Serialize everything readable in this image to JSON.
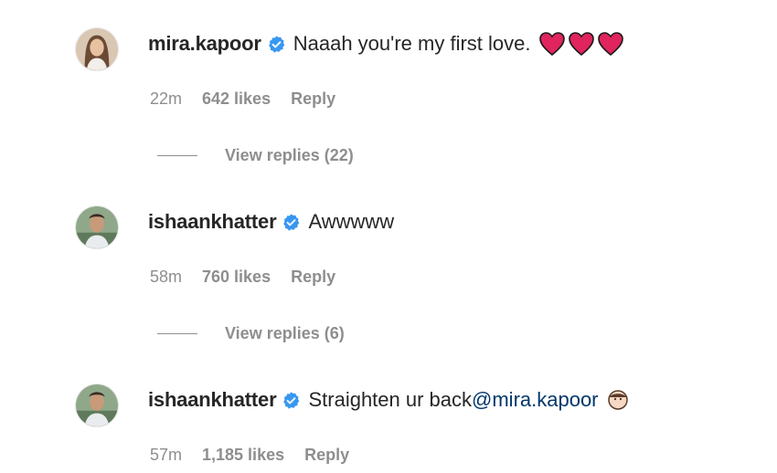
{
  "comments": [
    {
      "username": "mira.kapoor",
      "text": "Naaah you're my first love.",
      "time": "22m",
      "likes": "642 likes",
      "reply": "Reply",
      "view_replies": "View replies (22)",
      "emoji": [
        "red-heart",
        "red-heart",
        "red-heart"
      ]
    },
    {
      "username": "ishaankhatter",
      "text": "Awwwww",
      "time": "58m",
      "likes": "760 likes",
      "reply": "Reply",
      "view_replies": "View replies (6)"
    },
    {
      "username": "ishaankhatter",
      "text": "Straighten ur back ",
      "mention": "@mira.kapoor",
      "time": "57m",
      "likes": "1,185 likes",
      "reply": "Reply",
      "emoji": [
        "face"
      ]
    }
  ],
  "colors": {
    "username": "#262626",
    "meta": "#8e8e8e",
    "verified": "#3897f0",
    "heart": "#e0245e",
    "mention": "#00376b"
  }
}
